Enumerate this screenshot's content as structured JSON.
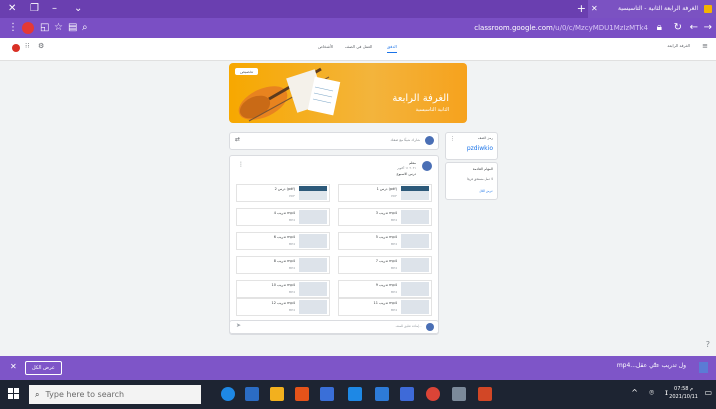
{
  "window": {
    "tab_title": "الغرفة الرابعة الثانية - التاسيسية",
    "controls": {
      "close": "✕",
      "new_tab": "+"
    }
  },
  "addressbar": {
    "url_host": "classroom.google.com",
    "url_path": "/u/0/c/MzcyMDU1MzIzMTk4"
  },
  "classroom": {
    "tabs": [
      "الأشخاص",
      "العمل في الصف",
      "الدفق"
    ],
    "active_tab": "الدفق",
    "banner": {
      "class_name": "الغرفة الرابعة",
      "section": "الثانية التاسيسية",
      "customize_label": "تخصيص"
    },
    "code_card": {
      "title": "رمز الصف",
      "code": "pzdiwkio"
    },
    "upcoming_card": {
      "title": "المهام القادمة",
      "body": "لا عمل مستحق قريبًا",
      "link": "عرض الكل"
    },
    "announce_placeholder": "شارك شيئًا مع صفك",
    "post": {
      "author": "معلم",
      "date": "٢٠٢١ ١١ أكتوبر",
      "text": "درس الاسبوع",
      "attachments": [
        {
          "label": "درس 1 (pdf)",
          "type": "PDF"
        },
        {
          "label": "درس 2 (pdf)",
          "type": "PDF"
        },
        {
          "label": "تدريب 3 mp4",
          "type": "MP4"
        },
        {
          "label": "تدريب 4 mp4",
          "type": "MP4"
        },
        {
          "label": "تدريب 5 mp4",
          "type": "MP4"
        },
        {
          "label": "تدريب 6 mp4",
          "type": "MP4"
        },
        {
          "label": "تدريب 7 mp4",
          "type": "MP4"
        },
        {
          "label": "تدريب 8 mp4",
          "type": "MP4"
        },
        {
          "label": "تدريب 9 mp4",
          "type": "MP4"
        },
        {
          "label": "تدريب 10 mp4",
          "type": "MP4"
        },
        {
          "label": "تدريب 11 mp4",
          "type": "MP4"
        },
        {
          "label": "تدريب 12 mp4",
          "type": "MP4"
        }
      ],
      "comment_placeholder": "إضافة تعليق للصف..."
    }
  },
  "downloads": {
    "show_all": "عرض الكل",
    "file": "mp4...ول تدريب علي عقل"
  },
  "taskbar": {
    "search_placeholder": "Type here to search",
    "time": "07:58 م",
    "date": "2021/10/11"
  },
  "colors": {
    "window": "#6a3fb0",
    "accent": "#1a73e8",
    "banner": "#f7a800"
  }
}
